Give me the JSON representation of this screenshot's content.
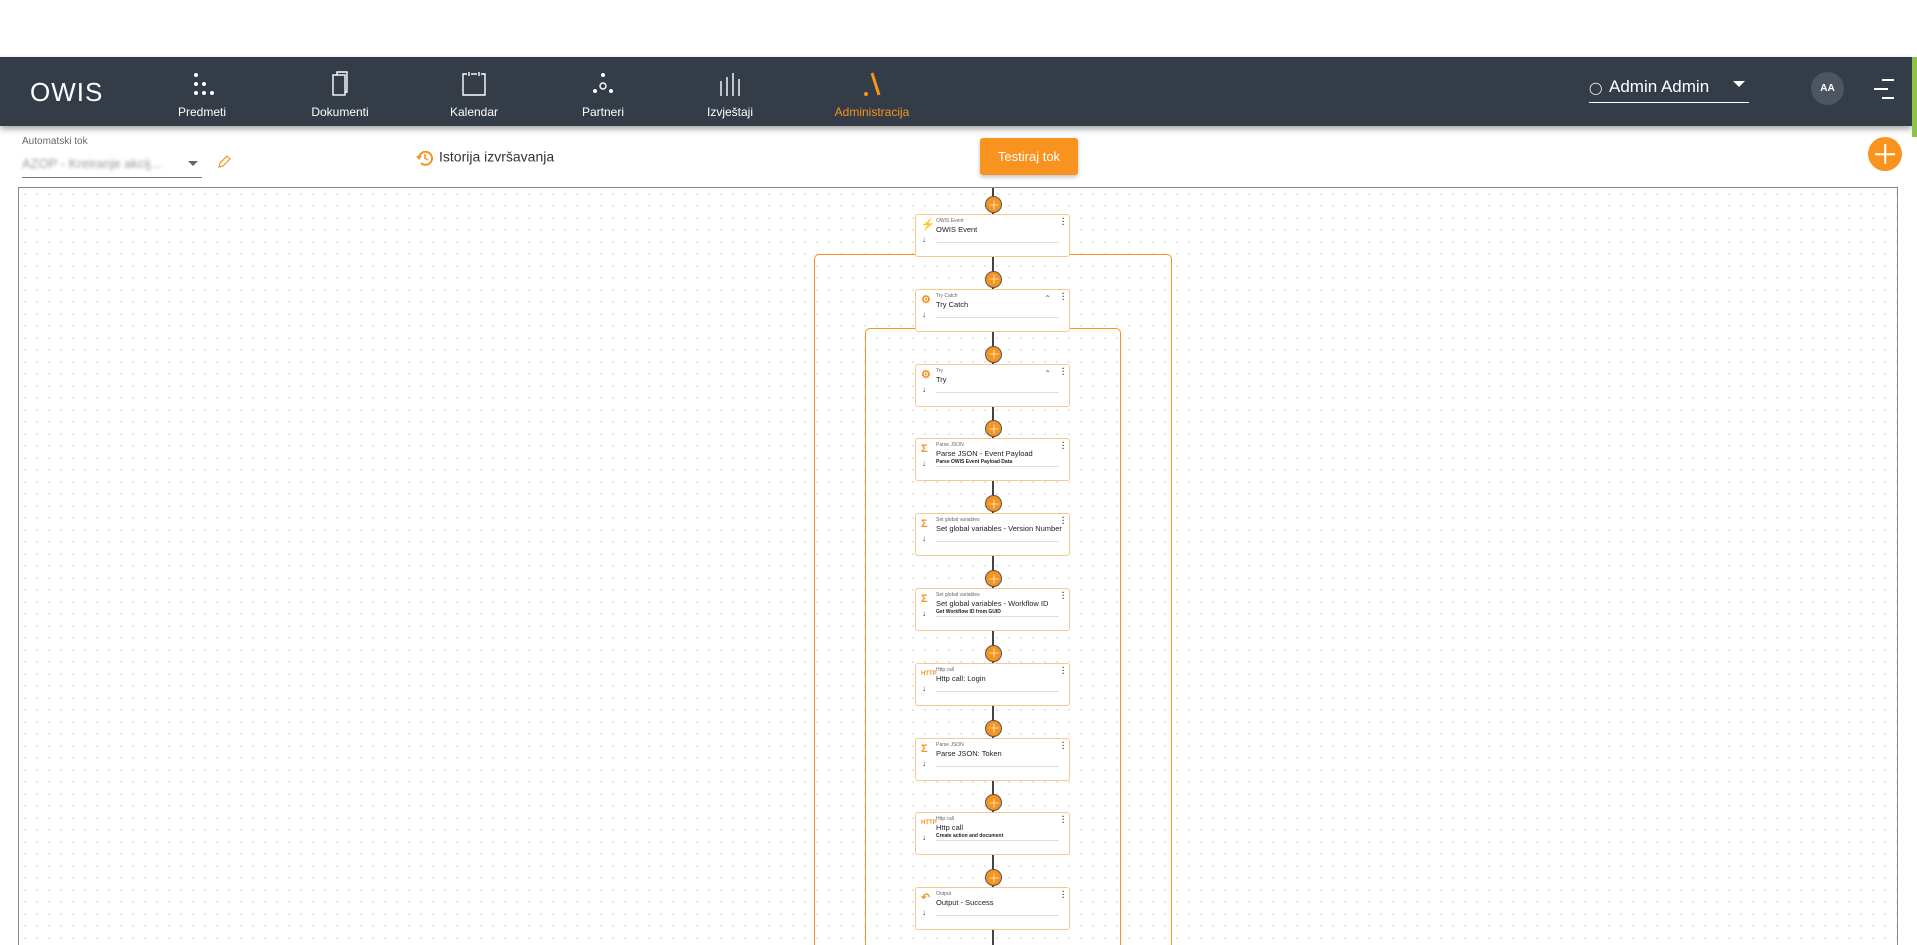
{
  "app": {
    "logo": "OWIS"
  },
  "nav": [
    {
      "label": "Predmeti",
      "icon": "dots-grid-icon"
    },
    {
      "label": "Dokumenti",
      "icon": "documents-icon"
    },
    {
      "label": "Kalendar",
      "icon": "calendar-icon"
    },
    {
      "label": "Partneri",
      "icon": "partners-icon"
    },
    {
      "label": "Izvještaji",
      "icon": "reports-icon"
    },
    {
      "label": "Administracija",
      "icon": "admin-icon",
      "active": true
    }
  ],
  "user": {
    "name": "Admin Admin",
    "initials": "AA"
  },
  "toolbar": {
    "flow_label": "Automatski tok",
    "flow_value": "AZOP - Kreiranje akcij...",
    "history_label": "Istorija izvršavanja",
    "test_label": "Testiraj tok"
  },
  "colors": {
    "accent": "#f7931e",
    "nav_bg": "#343d47"
  },
  "nodes": [
    {
      "type": "OWIS Event",
      "title": "OWIS Event",
      "sub": "",
      "icon": "bolt-icon"
    },
    {
      "type": "Try Catch",
      "title": "Try Catch",
      "sub": "",
      "icon": "gear-icon",
      "collapsible": true
    },
    {
      "type": "Try",
      "title": "Try",
      "sub": "",
      "icon": "gear-icon",
      "collapsible": true
    },
    {
      "type": "Parse JSON",
      "title": "Parse JSON - Event Payload",
      "sub": "Parse OWIS Event Payload Data",
      "icon": "sigma-icon"
    },
    {
      "type": "Set global variables",
      "title": "Set global variables - Version Number",
      "sub": "",
      "icon": "sigma-icon"
    },
    {
      "type": "Set global variables",
      "title": "Set global variables - Workflow ID",
      "sub": "Get Workflow ID from GUID",
      "icon": "sigma-icon"
    },
    {
      "type": "Http call",
      "title": "Http call: Login",
      "sub": "",
      "icon": "http-icon"
    },
    {
      "type": "Parse JSON",
      "title": "Parse JSON: Token",
      "sub": "",
      "icon": "sigma-icon"
    },
    {
      "type": "Http call",
      "title": "Http call",
      "sub": "Create action and document",
      "icon": "http-icon"
    },
    {
      "type": "Output",
      "title": "Output - Success",
      "sub": "",
      "icon": "reply-icon"
    }
  ]
}
